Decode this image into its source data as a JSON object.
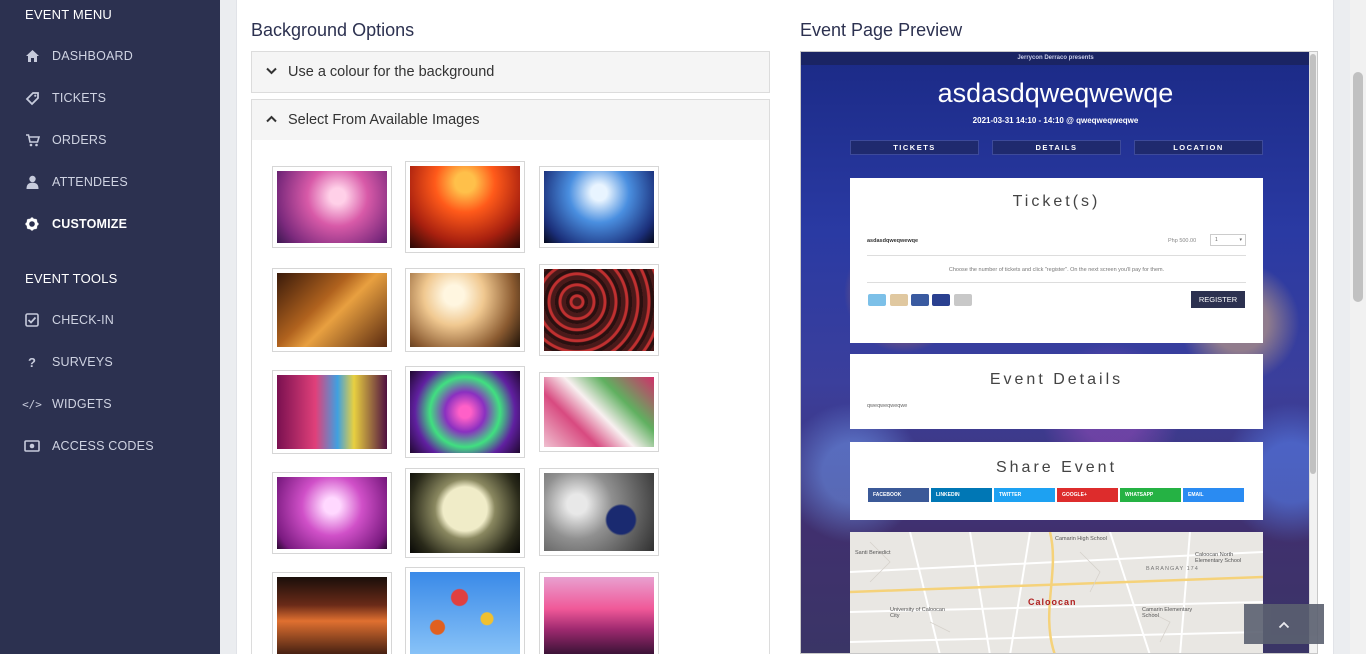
{
  "sidebar": {
    "event_menu_heading": "EVENT MENU",
    "event_tools_heading": "EVENT TOOLS",
    "menu_items": [
      {
        "label": "DASHBOARD",
        "icon": "home-icon"
      },
      {
        "label": "TICKETS",
        "icon": "ticket-icon"
      },
      {
        "label": "ORDERS",
        "icon": "cart-icon"
      },
      {
        "label": "ATTENDEES",
        "icon": "user-icon"
      },
      {
        "label": "CUSTOMIZE",
        "icon": "gear-icon",
        "active": true
      }
    ],
    "tool_items": [
      {
        "label": "CHECK-IN",
        "icon": "checkbox-icon"
      },
      {
        "label": "SURVEYS",
        "icon": "question-icon"
      },
      {
        "label": "WIDGETS",
        "icon": "code-icon"
      },
      {
        "label": "ACCESS CODES",
        "icon": "money-icon"
      }
    ]
  },
  "background_options": {
    "title": "Background Options",
    "colour_option_label": "Use a colour for the background",
    "images_option_label": "Select From Available Images",
    "thumbnails": [
      "pink-bokeh-image",
      "concert-red-image",
      "concert-blue-lights-image",
      "restaurant-interior-image",
      "fireworks-crowd-image",
      "crowd-aerial-image",
      "night-street-image",
      "purple-swirl-image",
      "gift-boxes-image",
      "champagne-bottles-image",
      "full-moon-image",
      "christmas-ornament-image",
      "bar-interior-image",
      "hot-air-balloons-image",
      "pink-sky-crowd-image"
    ]
  },
  "preview": {
    "title": "Event Page Preview",
    "presenter": "Jerrycon Derraco presents",
    "event_name": "asdasdqweqwewqe",
    "event_datetime": "2021-03-31 14:10 - 14:10 @ qweqweqweqwe",
    "tabs": [
      "TICKETS",
      "DETAILS",
      "LOCATION"
    ],
    "tickets_heading": "Ticket(s)",
    "ticket_name": "asdasdqweqwewqe",
    "ticket_price": "Php 500.00",
    "ticket_qty": "1",
    "ticket_note": "Choose the number of tickets and click \"register\". On the next screen you'll pay for them.",
    "register_label": "REGISTER",
    "details_heading": "Event Details",
    "details_text": "qweqweqweqwe",
    "share_heading": "Share Event",
    "share_buttons": [
      {
        "label": "FACEBOOK",
        "color": "#3b5998"
      },
      {
        "label": "LINKEDIN",
        "color": "#0077b5"
      },
      {
        "label": "TWITTER",
        "color": "#1da1f2"
      },
      {
        "label": "GOOGLE+",
        "color": "#dd2c2c"
      },
      {
        "label": "WHATSAPP",
        "color": "#25b244"
      },
      {
        "label": "EMAIL",
        "color": "#2a8bf2"
      }
    ],
    "map": {
      "main_label": "Caloocan",
      "labels": [
        "Camarin High School",
        "BARANGAY 174",
        "Caloocan North Elementary School",
        "Santi Benedict",
        "University of Caloocan City",
        "Camarin Elementary School"
      ]
    }
  },
  "colors": {
    "sidebar_bg": "#2c3150",
    "accent": "#2c3150"
  }
}
